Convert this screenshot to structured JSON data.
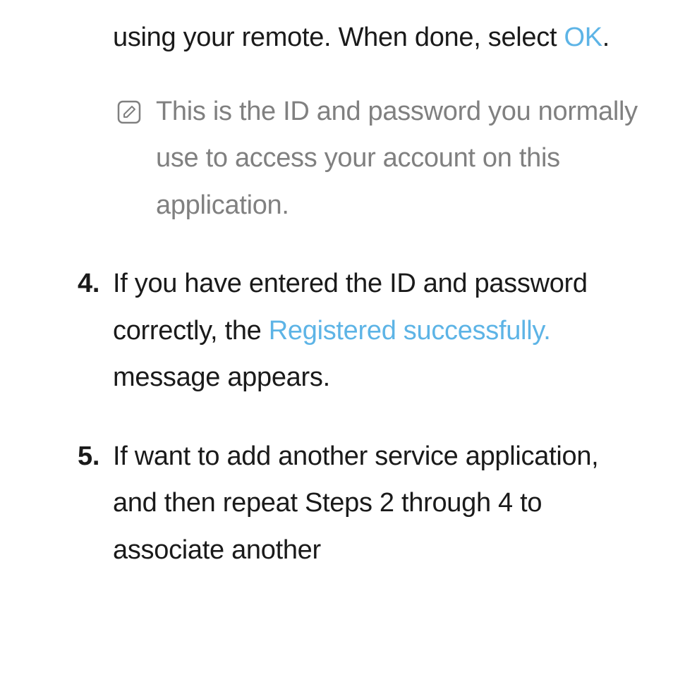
{
  "colors": {
    "highlight": "#5db4e6",
    "noteText": "#808080",
    "bodyText": "#1a1a1a"
  },
  "continuation": {
    "text_before": "using your remote. When done, select ",
    "highlight": "OK",
    "text_after": "."
  },
  "note": {
    "icon_name": "note-pencil-icon",
    "text": "This is the ID and password you normally use to access your account on this application."
  },
  "steps": [
    {
      "number": "4.",
      "text_before": "If you have entered the ID and password correctly, the ",
      "highlight": "Registered successfully.",
      "text_after": " message appears."
    },
    {
      "number": "5.",
      "text_before": "If want to add another service application, and then  repeat Steps 2 through 4 to associate another",
      "highlight": "",
      "text_after": ""
    }
  ]
}
